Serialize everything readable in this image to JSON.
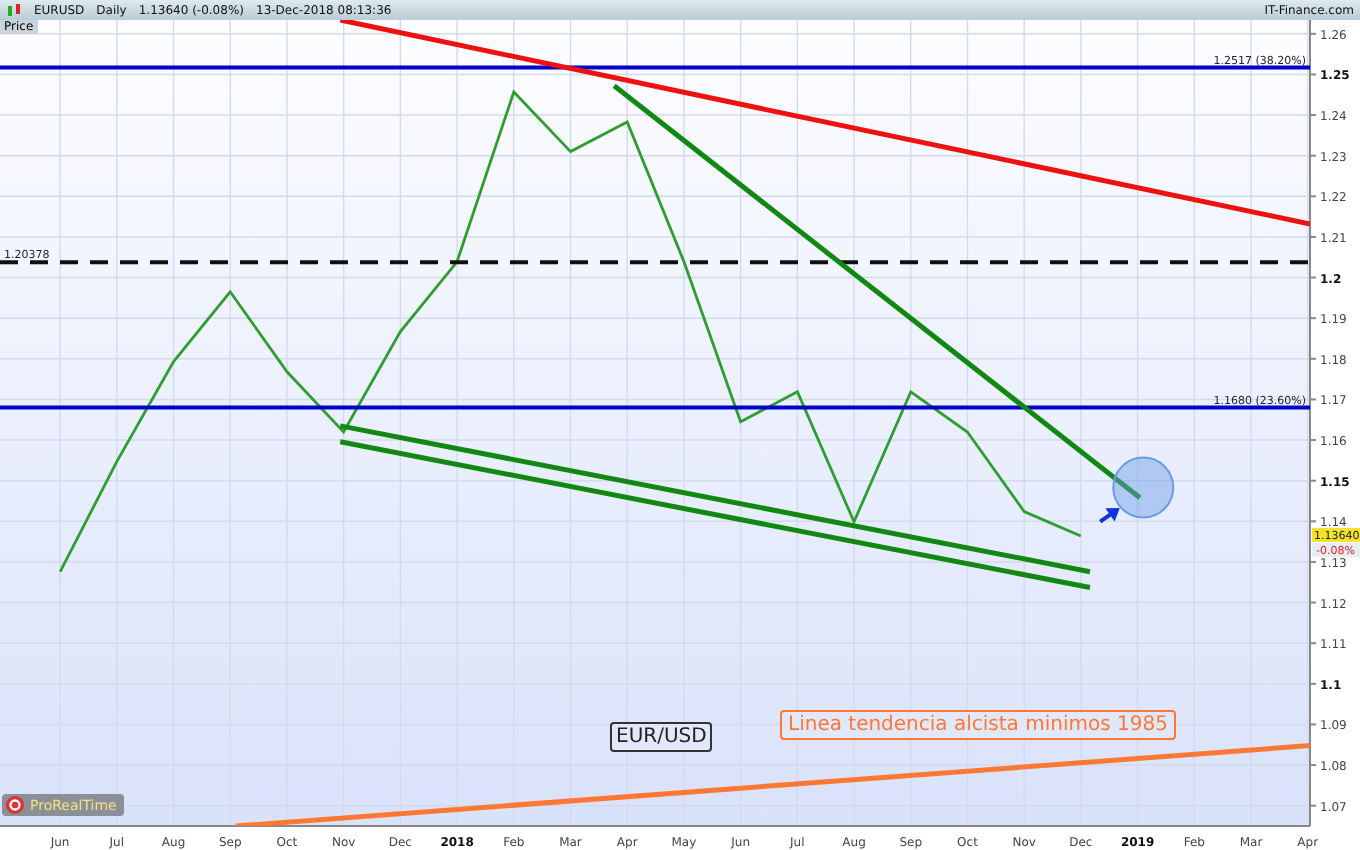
{
  "header": {
    "symbol": "EURUSD",
    "period": "Daily",
    "quote": "1.13640 (-0.08%)",
    "timestamp": "13-Dec-2018 08:13:36",
    "source": "IT-Finance.com"
  },
  "price_label": "Price",
  "chart": {
    "chart_data": {
      "type": "line",
      "ylim": [
        1.065,
        1.2634
      ],
      "categories": [
        "Jun",
        "Jul",
        "Aug",
        "Sep",
        "Oct",
        "Nov",
        "Dec",
        "2018",
        "Feb",
        "Mar",
        "Apr",
        "May",
        "Jun",
        "Jul",
        "Aug",
        "Sep",
        "Oct",
        "Nov",
        "Dec",
        "2019",
        "Feb",
        "Mar",
        "Apr"
      ],
      "series": [
        {
          "name": "EUR/USD",
          "color": "#2e9e2e",
          "values": [
            1.1276,
            1.1547,
            1.1793,
            1.1965,
            1.1768,
            1.162,
            1.1867,
            1.2039,
            1.2457,
            1.231,
            1.2383,
            1.2039,
            1.1645,
            1.1719,
            1.1399,
            1.1719,
            1.162,
            1.1424,
            1.1364,
            null,
            null,
            null,
            null
          ]
        }
      ],
      "yticks": [
        1.07,
        1.08,
        1.09,
        1.1,
        1.11,
        1.12,
        1.13,
        1.14,
        1.15,
        1.16,
        1.17,
        1.18,
        1.19,
        1.2,
        1.21,
        1.22,
        1.23,
        1.24,
        1.25,
        1.26
      ],
      "grid": true
    },
    "level_labels": [
      "1.2517 (38.20%)",
      "1.20378",
      "1.1680 (23.60%)"
    ],
    "note": "Linea tendencia alcista minimos 1985"
  },
  "price_tag": "1.13640",
  "change_tag": "-0.08%",
  "badge": "ProRealTime"
}
